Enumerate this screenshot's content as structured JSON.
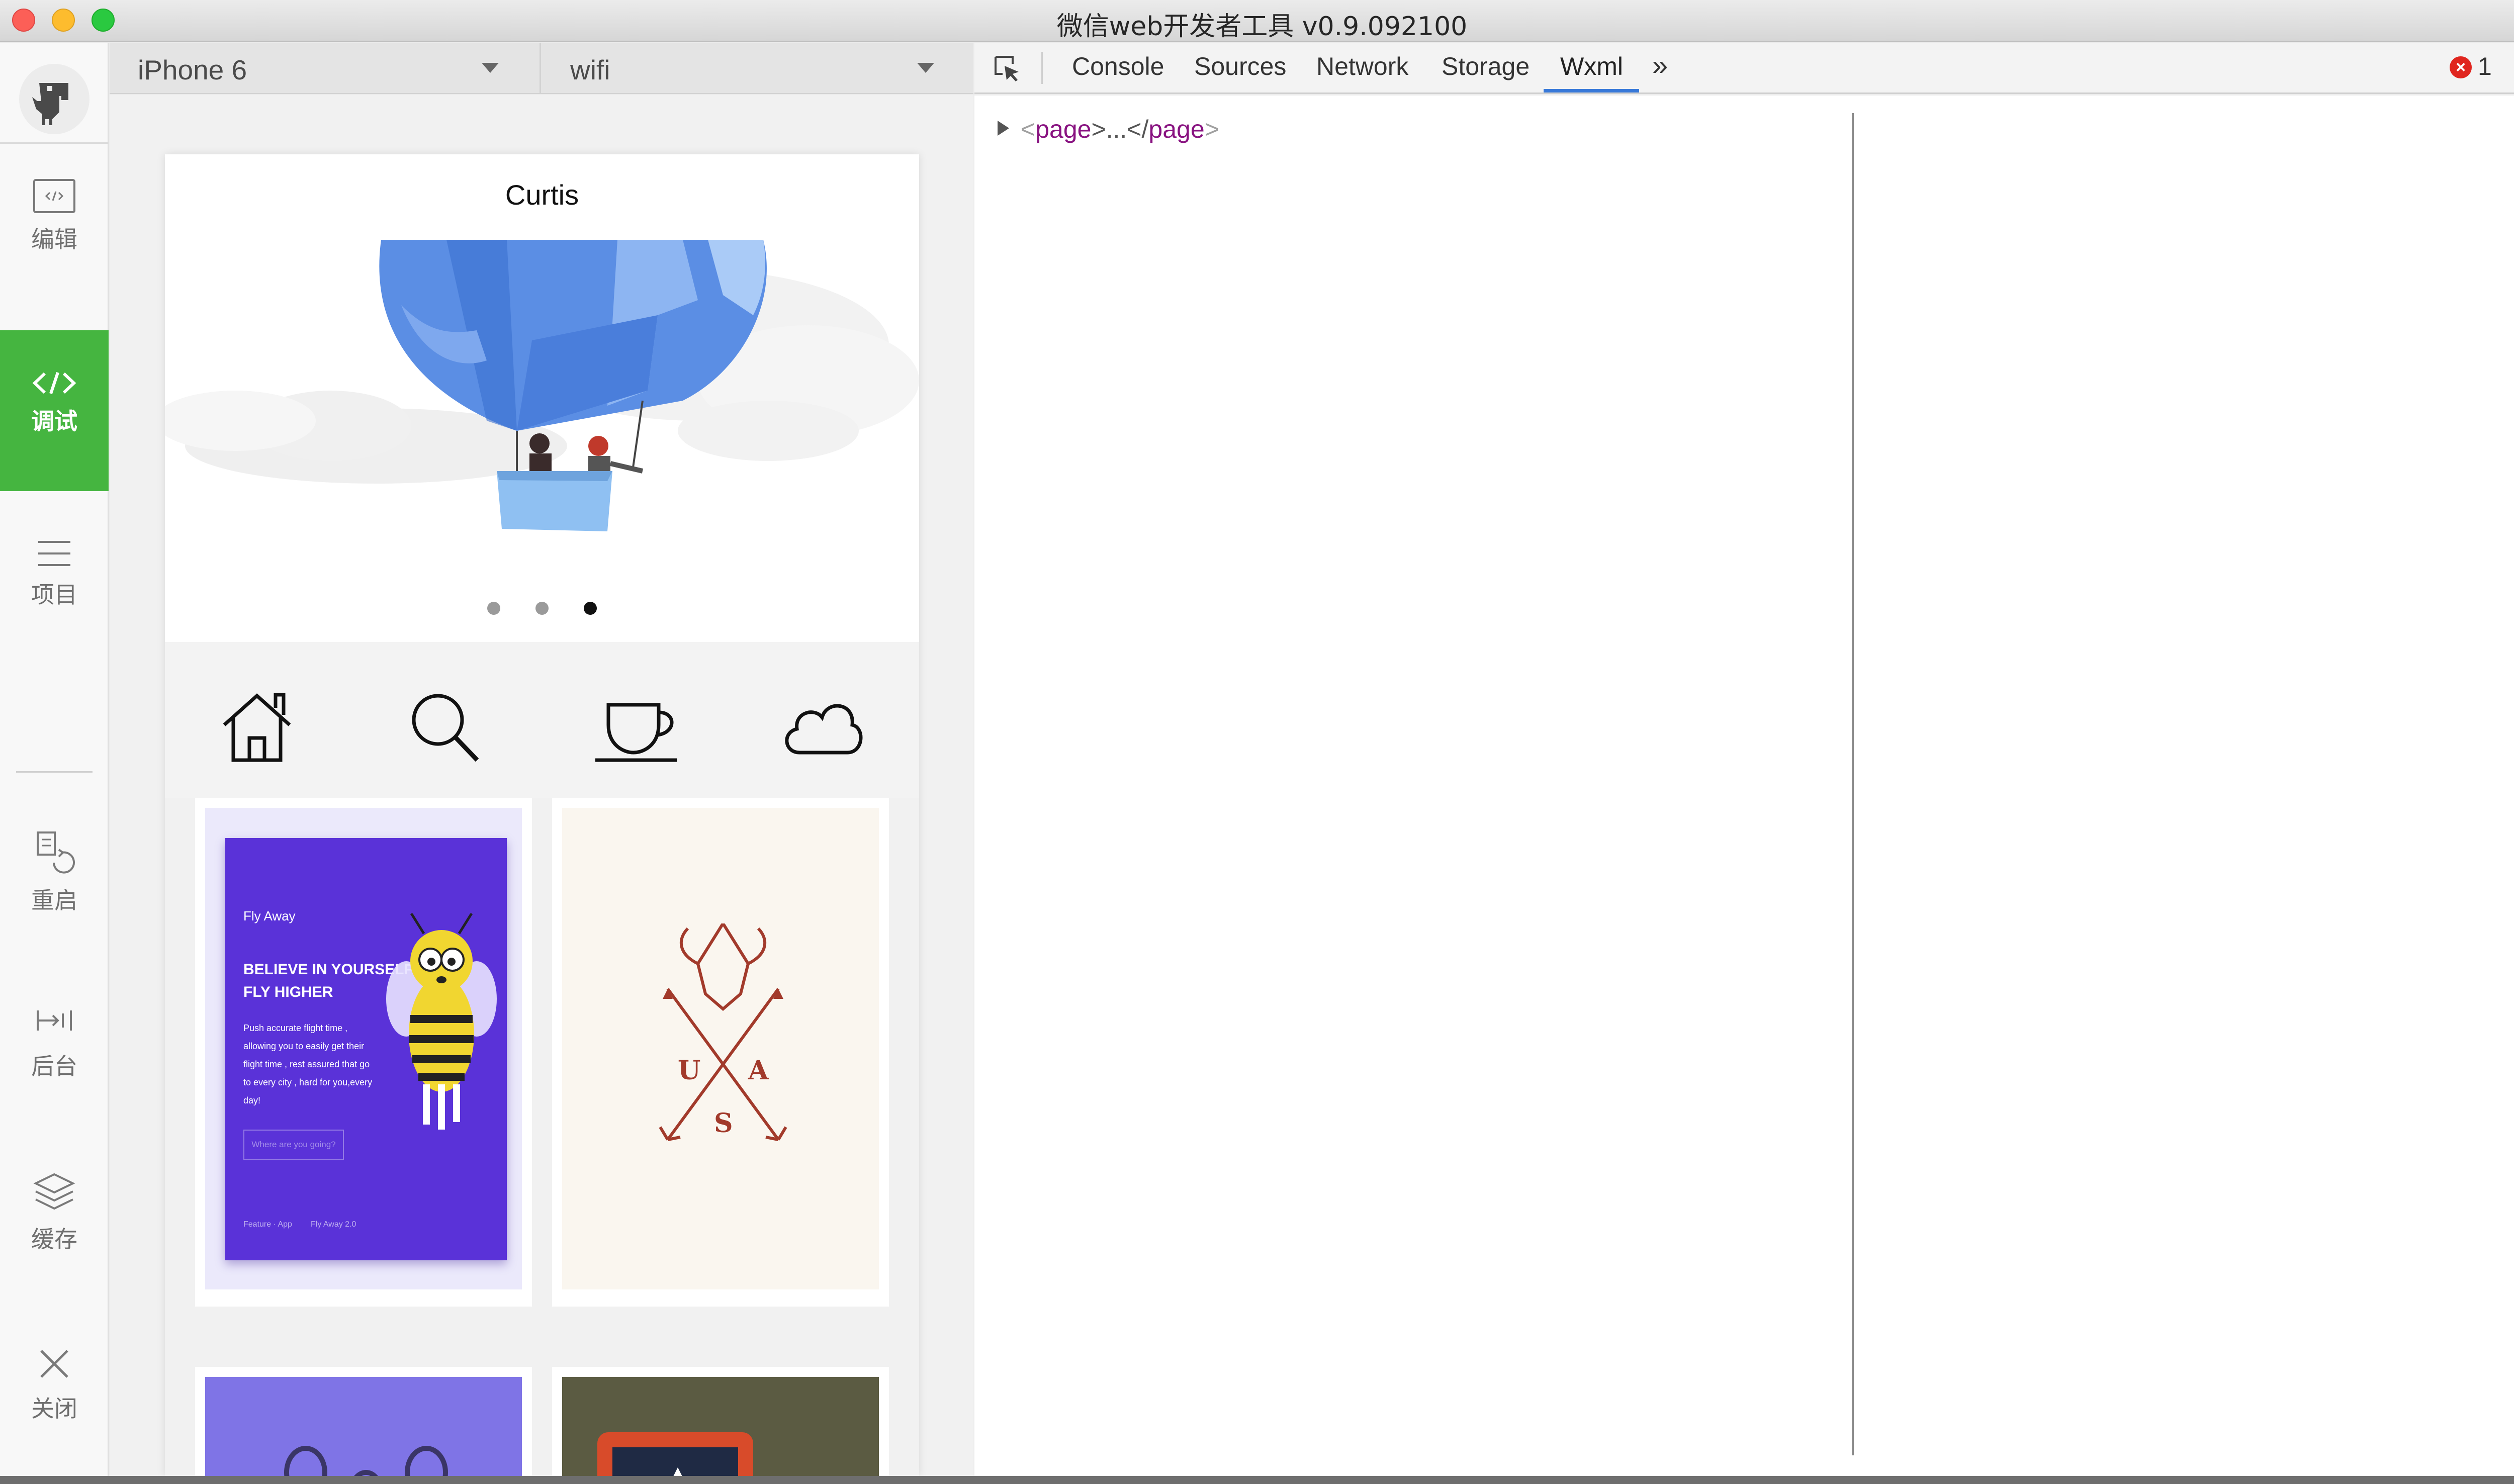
{
  "window": {
    "title": "微信web开发者工具 v0.9.092100"
  },
  "sidebar": {
    "logo_icon": "dinosaur-logo-icon",
    "items": [
      {
        "label": "编辑",
        "icon": "code-editor-icon"
      },
      {
        "label": "调试",
        "icon": "code-brackets-icon",
        "active": true
      },
      {
        "label": "项目",
        "icon": "menu-lines-icon"
      },
      {
        "label": "重启",
        "icon": "restart-icon"
      },
      {
        "label": "后台",
        "icon": "background-icon"
      },
      {
        "label": "缓存",
        "icon": "layers-icon"
      },
      {
        "label": "关闭",
        "icon": "close-icon"
      }
    ],
    "accent_color": "#45b540"
  },
  "simulator": {
    "device": "iPhone 6",
    "network": "wifi",
    "page": {
      "nav_title": "Curtis",
      "carousel": {
        "slides": 3,
        "active_index": 2
      },
      "category_icons": [
        "home-icon",
        "search-icon",
        "coffee-icon",
        "cloud-icon"
      ],
      "cards": [
        {
          "brand": "Fly Away",
          "headline_1": "BELIEVE IN YOURSELF",
          "headline_2": "FLY HIGHER",
          "body": "Push accurate flight time , allowing you to easily get their flight time , rest assured that go to every city , hard for you,every day!",
          "cta": "Where are you going?",
          "footer_left": "Feature · App",
          "footer_right": "Fly Away 2.0"
        },
        {
          "emblem_letters": [
            "U",
            "A",
            "S"
          ]
        }
      ]
    }
  },
  "devtools": {
    "tabs": [
      "Console",
      "Sources",
      "Network",
      "Storage",
      "Wxml"
    ],
    "active_tab": "Wxml",
    "more_icon": "double-chevron-right-icon",
    "error_count": "1",
    "tree": {
      "open": "<",
      "tag": "page",
      "mid": ">...</",
      "close": ">"
    }
  }
}
